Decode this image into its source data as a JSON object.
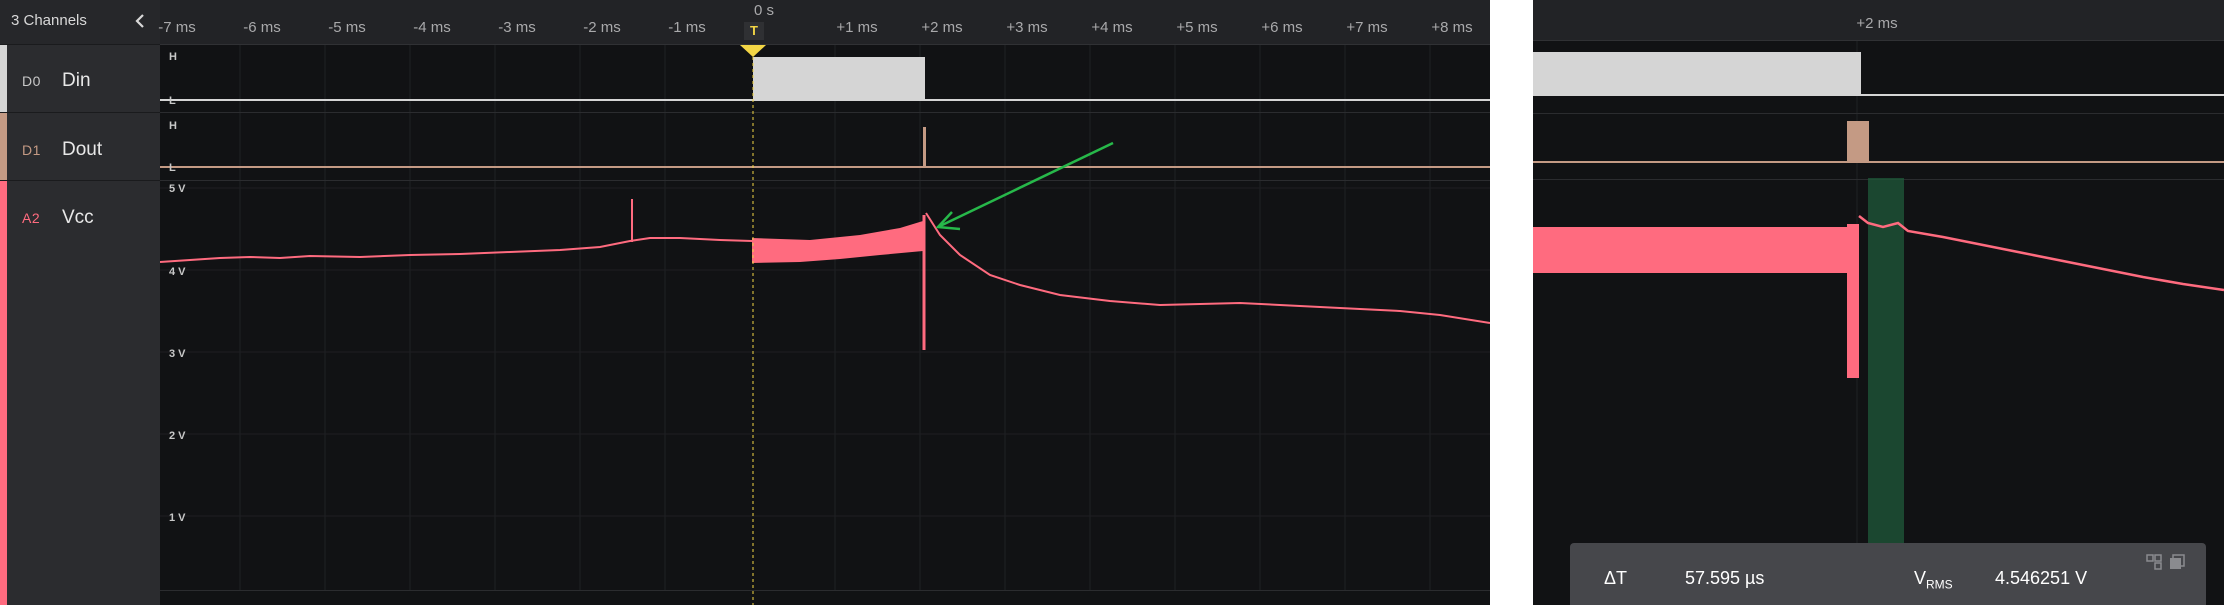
{
  "sidebar": {
    "title": "3 Channels",
    "channels": [
      {
        "id": "D0",
        "name": "Din",
        "color": "#d5d5d5"
      },
      {
        "id": "D1",
        "name": "Dout",
        "color": "#c49a84"
      },
      {
        "id": "A2",
        "name": "Vcc",
        "color": "#ff6b7f"
      }
    ]
  },
  "ruler": {
    "zero_label": "0 s",
    "trigger_label": "T",
    "ticks": [
      "-7 ms",
      "-6 ms",
      "-5 ms",
      "-4 ms",
      "-3 ms",
      "-2 ms",
      "-1 ms",
      "+1 ms",
      "+2 ms",
      "+3 ms",
      "+4 ms",
      "+5 ms",
      "+6 ms",
      "+7 ms",
      "+8 ms"
    ],
    "right_tick": "+2 ms"
  },
  "levels": {
    "high": "H",
    "low": "L"
  },
  "voltage_labels": [
    "5 V",
    "4 V",
    "3 V",
    "2 V",
    "1 V"
  ],
  "measurement": {
    "delta_t_label": "ΔT",
    "delta_t_value": "57.595 µs",
    "vrms_label": "V",
    "vrms_sub": "RMS",
    "vrms_value": "4.546251 V"
  },
  "colors": {
    "annotation_arrow": "#27b84a",
    "trigger": "#f2d545",
    "analog": "#ff6b7f",
    "cursor_region": "#1f5a3a"
  }
}
